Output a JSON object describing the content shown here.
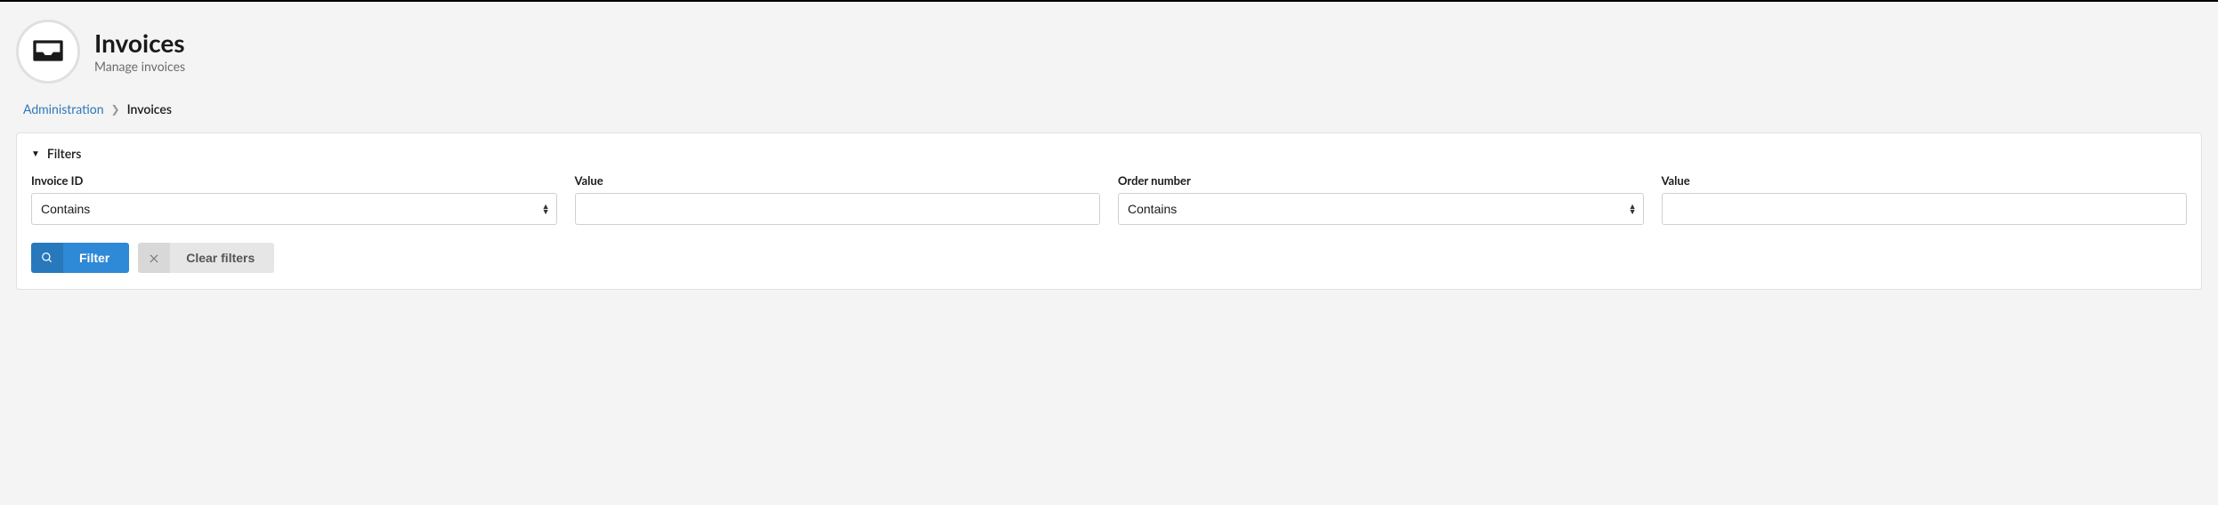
{
  "header": {
    "title": "Invoices",
    "subtitle": "Manage invoices"
  },
  "breadcrumb": {
    "parent": "Administration",
    "current": "Invoices"
  },
  "filters_panel": {
    "title": "Filters",
    "fields": {
      "invoice_id": {
        "label": "Invoice ID",
        "operator": "Contains"
      },
      "invoice_id_value": {
        "label": "Value",
        "value": ""
      },
      "order_number": {
        "label": "Order number",
        "operator": "Contains"
      },
      "order_number_value": {
        "label": "Value",
        "value": ""
      }
    },
    "buttons": {
      "filter": "Filter",
      "clear": "Clear filters"
    }
  }
}
